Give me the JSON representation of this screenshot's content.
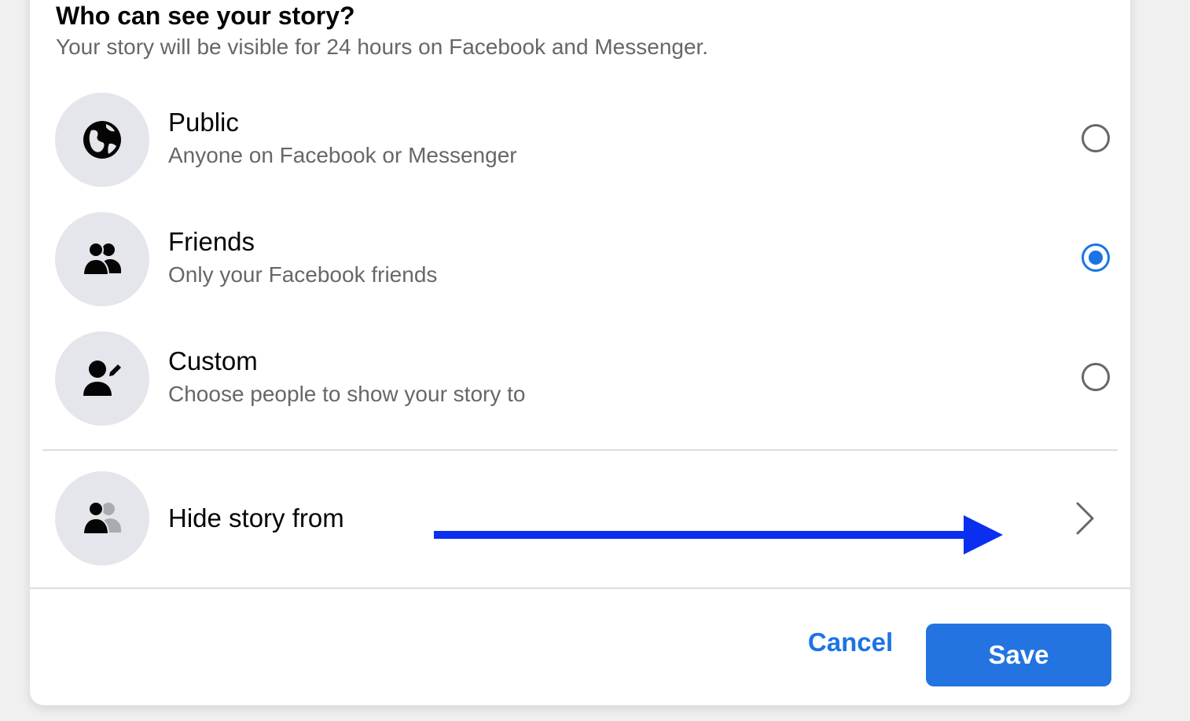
{
  "dialog": {
    "heading": "Who can see your story?",
    "subheading": "Your story will be visible for 24 hours on Facebook and Messenger."
  },
  "options": [
    {
      "title": "Public",
      "subtitle": "Anyone on Facebook or Messenger",
      "icon": "globe-icon",
      "selected": false
    },
    {
      "title": "Friends",
      "subtitle": "Only your Facebook friends",
      "icon": "friends-icon",
      "selected": true
    },
    {
      "title": "Custom",
      "subtitle": "Choose people to show your story to",
      "icon": "person-edit-icon",
      "selected": false
    }
  ],
  "hide_story": {
    "label": "Hide story from",
    "icon": "friends-hidden-icon"
  },
  "footer": {
    "cancel_label": "Cancel",
    "save_label": "Save"
  },
  "colors": {
    "accent": "#1b74e4",
    "save_button": "#2374e1",
    "annotation_arrow": "#0a2ff0",
    "icon_bg": "#e4e6eb"
  }
}
